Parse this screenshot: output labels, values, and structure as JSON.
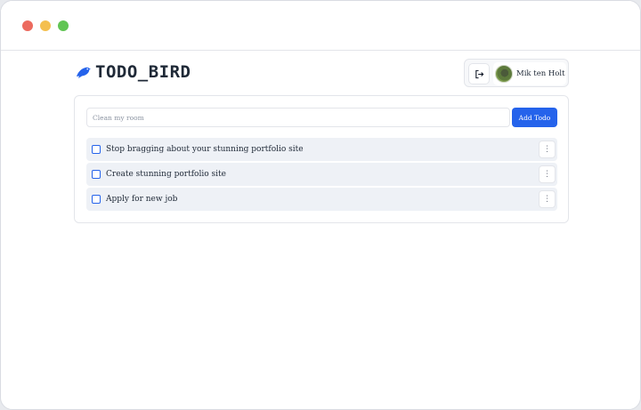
{
  "window": {
    "controls": [
      "close",
      "minimize",
      "maximize"
    ]
  },
  "header": {
    "brand": "TODO_BIRD",
    "brand_icon": "bird-icon",
    "logout_icon": "logout-icon",
    "user_name": "Mik ten Holt"
  },
  "todo_form": {
    "placeholder": "Clean my room",
    "value": "",
    "add_label": "Add Todo"
  },
  "todos": [
    {
      "text": "Stop bragging about your stunning portfolio site",
      "checked": false
    },
    {
      "text": "Create stunning portfolio site",
      "checked": false
    },
    {
      "text": "Apply for new job",
      "checked": false
    }
  ],
  "menu_glyph": "⋮",
  "colors": {
    "accent": "#2563eb",
    "item_background": "#eef1f6",
    "close": "#ec6a5e",
    "minimize": "#f4bf4f",
    "maximize": "#61c554"
  }
}
